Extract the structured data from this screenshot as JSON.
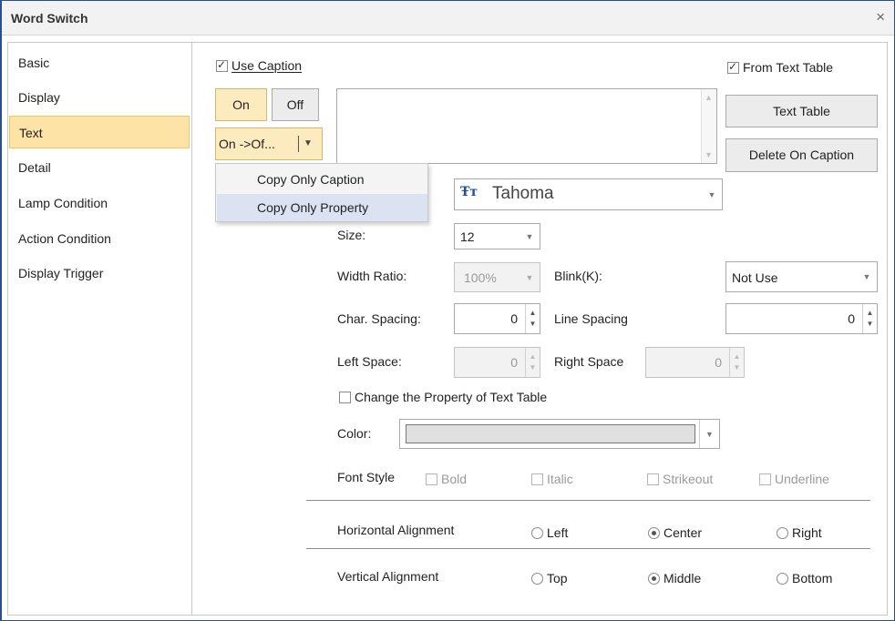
{
  "window": {
    "title": "Word Switch",
    "close": "×"
  },
  "sidebar": {
    "items": [
      {
        "label": "Basic"
      },
      {
        "label": "Display"
      },
      {
        "label": "Text"
      },
      {
        "label": "Detail"
      },
      {
        "label": "Lamp Condition"
      },
      {
        "label": "Action Condition"
      },
      {
        "label": "Display Trigger"
      }
    ],
    "active": "Text"
  },
  "caption": {
    "use_caption": {
      "label": "Use Caption",
      "checked": true
    },
    "from_text_table": {
      "label": "From Text Table",
      "checked": true
    },
    "on_button": "On",
    "off_button": "Off",
    "copy_dropdown": "On ->Of...",
    "text_table_button": "Text Table",
    "delete_caption_button": "Delete On Caption",
    "text_value": ""
  },
  "copy_menu": {
    "items": [
      {
        "label": "Copy Only Caption"
      },
      {
        "label": "Copy Only Property"
      }
    ]
  },
  "font": {
    "icon": "Ŧт",
    "name": "Tahoma"
  },
  "size": {
    "label": "Size:",
    "value": "12"
  },
  "width_ratio": {
    "label": "Width Ratio:",
    "value": "100%"
  },
  "blink": {
    "label": "Blink(K):",
    "value": "Not Use"
  },
  "char_spacing": {
    "label": "Char. Spacing:",
    "value": "0"
  },
  "line_spacing": {
    "label": "Line Spacing",
    "value": "0"
  },
  "left_space": {
    "label": "Left Space:",
    "value": "0"
  },
  "right_space": {
    "label": "Right Space",
    "value": "0"
  },
  "change_property": {
    "label": "Change the Property of Text Table",
    "checked": false
  },
  "color": {
    "label": "Color:",
    "value": "#e0e0e0"
  },
  "font_style": {
    "label": "Font Style",
    "options": [
      {
        "label": "Bold",
        "checked": false
      },
      {
        "label": "Italic",
        "checked": false
      },
      {
        "label": "Strikeout",
        "checked": false
      },
      {
        "label": "Underline",
        "checked": false
      }
    ]
  },
  "h_align": {
    "label": "Horizontal Alignment",
    "options": [
      {
        "label": "Left",
        "checked": false
      },
      {
        "label": "Center",
        "checked": true
      },
      {
        "label": "Right",
        "checked": false
      }
    ]
  },
  "v_align": {
    "label": "Vertical Alignment",
    "options": [
      {
        "label": "Top",
        "checked": false
      },
      {
        "label": "Middle",
        "checked": true
      },
      {
        "label": "Bottom",
        "checked": false
      }
    ]
  }
}
